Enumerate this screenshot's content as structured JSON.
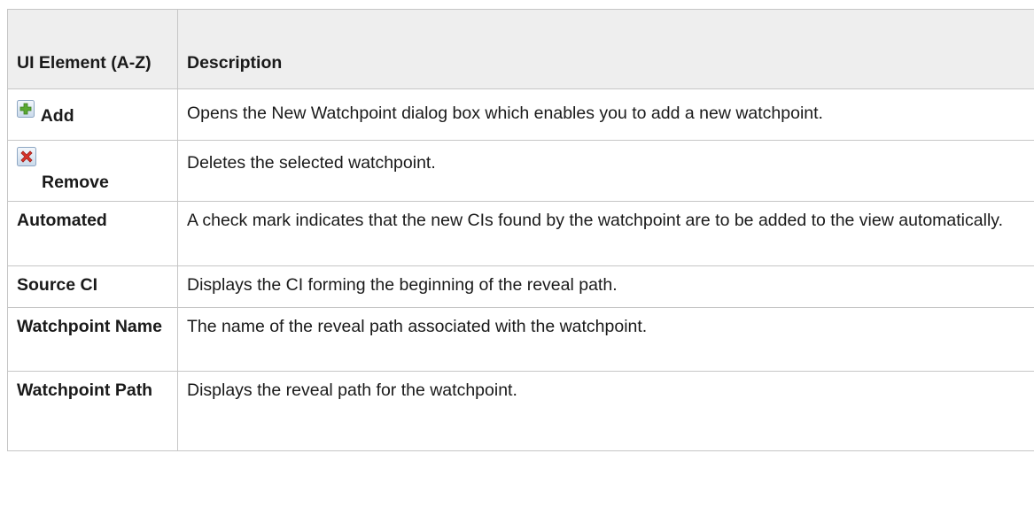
{
  "table": {
    "header": {
      "element_col": "UI Element (A-Z)",
      "description_col": "Description"
    },
    "rows": [
      {
        "element": "Add",
        "icon": "add-icon",
        "description": "Opens the New Watchpoint dialog box which enables you to add a new watchpoint."
      },
      {
        "element": "Remove",
        "icon": "remove-icon",
        "description": "Deletes the selected watchpoint."
      },
      {
        "element": "Automated",
        "description": "A check mark indicates that the new CIs found by the watchpoint are to be added to the view automatically."
      },
      {
        "element": "Source CI",
        "description": "Displays the CI forming the beginning of the reveal path."
      },
      {
        "element": "Watchpoint Name",
        "description": "The name of the reveal path associated with the watchpoint."
      },
      {
        "element": "Watchpoint Path",
        "description": "Displays the reveal path for the watchpoint."
      }
    ]
  },
  "colors": {
    "header_bg": "#eeeeee",
    "border": "#c6c6c6",
    "add_icon_accent": "#5aa832",
    "remove_icon_accent": "#d9342b"
  }
}
